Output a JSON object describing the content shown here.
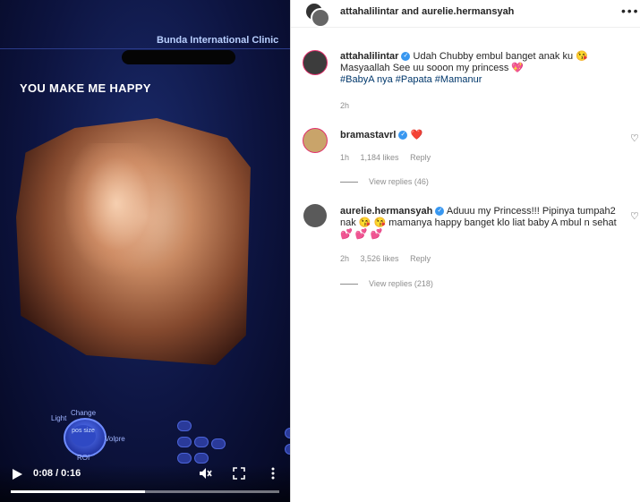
{
  "video": {
    "clinic_name": "Bunda International Clinic",
    "overlay_text": "YOU MAKE ME HAPPY",
    "dial_labels": {
      "light": "Light",
      "change": "Change",
      "volpre": "Volpre",
      "roi": "ROI",
      "center": "pos size"
    },
    "time": "0:08 / 0:16",
    "progress": 0.5
  },
  "header": {
    "names": "attahalilintar and aurelie.hermansyah"
  },
  "caption": {
    "username": "attahalilintar",
    "text_line1": "Udah Chubby embul banget anak ku 😘",
    "text_line2": "Masyaallah See uu sooon my princess 💖",
    "hashtags": "#BabyA nya #Papata #Mamanur",
    "time": "2h"
  },
  "comments": [
    {
      "username": "bramastavrl",
      "text": "❤️",
      "time": "1h",
      "likes": "1,184 likes",
      "reply": "Reply",
      "view_replies": "View replies (46)"
    },
    {
      "username": "aurelie.hermansyah",
      "text_line1": "Aduuu my Princess!!! Pipinya tumpah2",
      "text_line2": "nak 😘 😘  mamanya happy banget klo liat baby A mbul n sehat",
      "text_line3": "💕 💕 💕",
      "time": "2h",
      "likes": "3,526 likes",
      "reply": "Reply",
      "view_replies": "View replies (218)"
    }
  ],
  "colors": {
    "link": "#00376b",
    "verified": "#3897f0",
    "meta": "#8e8e8e"
  }
}
